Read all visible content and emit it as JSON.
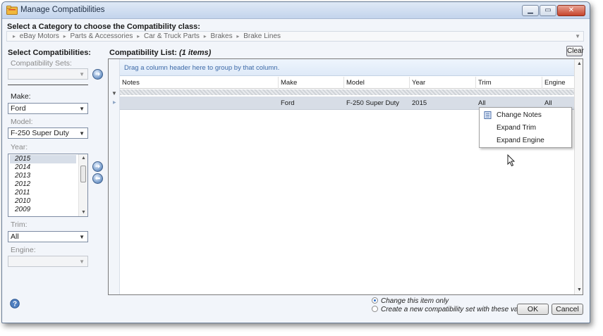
{
  "window": {
    "title": "Manage Compatibilities"
  },
  "category": {
    "prompt": "Select a Category to choose the Compatibility class:",
    "path": [
      "eBay Motors",
      "Parts & Accessories",
      "Car & Truck Parts",
      "Brakes",
      "Brake Lines"
    ]
  },
  "left": {
    "title": "Select Compatibilities:",
    "sets_label": "Compatibility Sets:",
    "sets_value": "",
    "make_label": "Make:",
    "make_value": "Ford",
    "model_label": "Model:",
    "model_value": "F-250 Super Duty",
    "year_label": "Year:",
    "years": [
      "2015",
      "2014",
      "2013",
      "2012",
      "2011",
      "2010",
      "2009"
    ],
    "selected_year": "2015",
    "trim_label": "Trim:",
    "trim_value": "All",
    "engine_label": "Engine:",
    "engine_value": ""
  },
  "list": {
    "title": "Compatibility List:",
    "count": "(1 items)",
    "clear_label": "Clear",
    "group_hint": "Drag a column header here to group by that column.",
    "columns": [
      "Notes",
      "Make",
      "Model",
      "Year",
      "Trim",
      "Engine"
    ],
    "rows": [
      {
        "notes": "",
        "make": "Ford",
        "model": "F-250 Super Duty",
        "year": "2015",
        "trim": "All",
        "engine": "All"
      }
    ]
  },
  "context_menu": {
    "items": [
      "Change Notes",
      "Expand Trim",
      "Expand Engine"
    ]
  },
  "footer": {
    "option_this": "Change this item only",
    "option_new": "Create a new compatibility set with these values",
    "selected_option": "option_this",
    "ok_label": "OK",
    "cancel_label": "Cancel"
  },
  "icons": {
    "app": "folder-icon",
    "help": "help-icon",
    "notes": "notes-icon",
    "add": "add-arrow-icon"
  },
  "colors": {
    "accent": "#3d6aa8",
    "selected_row": "#d7dde6",
    "titlebar": "#c3d4ec",
    "close": "#c6442c"
  }
}
